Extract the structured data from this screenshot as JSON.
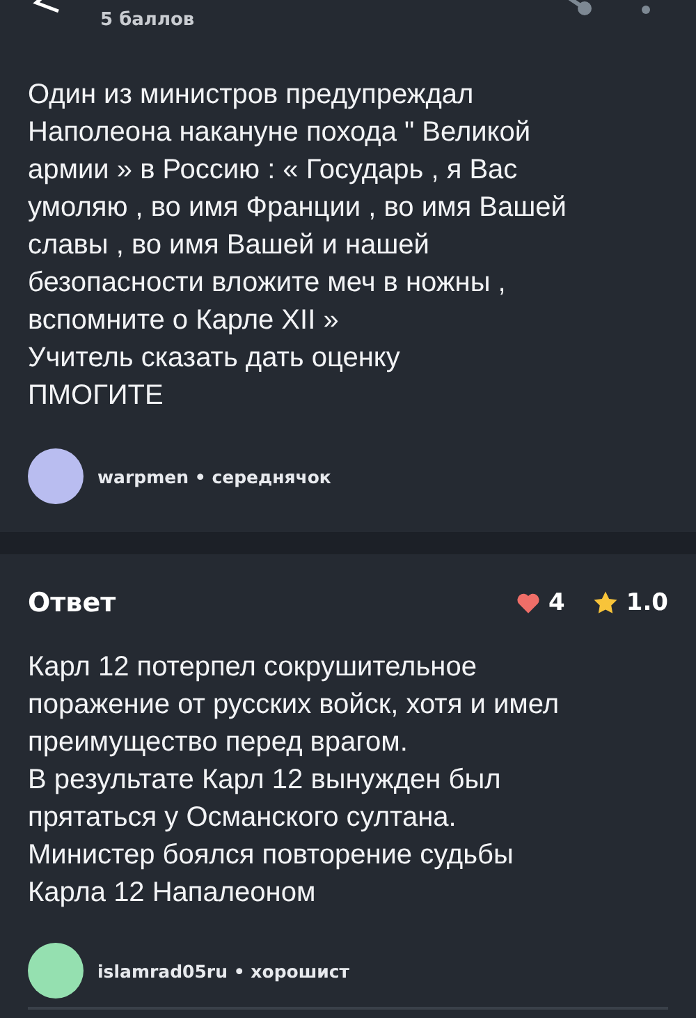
{
  "header": {
    "points": "5 баллов"
  },
  "question": {
    "text": "Один из министров предупреждал Наполеона накануне похода \" Великой армии » в Россию : « Государь , я Вас умоляю , во имя Франции , во имя Вашей славы , во имя Вашей и нашей безопасности вложите меч в ножны , вспомните о Карле XII »\nУчитель сказать дать оценку\nПМОГИТЕ",
    "author": "warpmen • середнячок"
  },
  "answer": {
    "title": "Ответ",
    "likes": "4",
    "rating": "1.0",
    "text": "Карл 12 потерпел сокрушительное поражение от русских войск, хотя и имел преимущество перед врагом.\nВ результате Карл 12 вынужден был прятаться у Османского султана.\nМинистер боялся повторение судьбы Карла 12 Напалеоном",
    "author": "islamrad05ru • хорошист"
  }
}
